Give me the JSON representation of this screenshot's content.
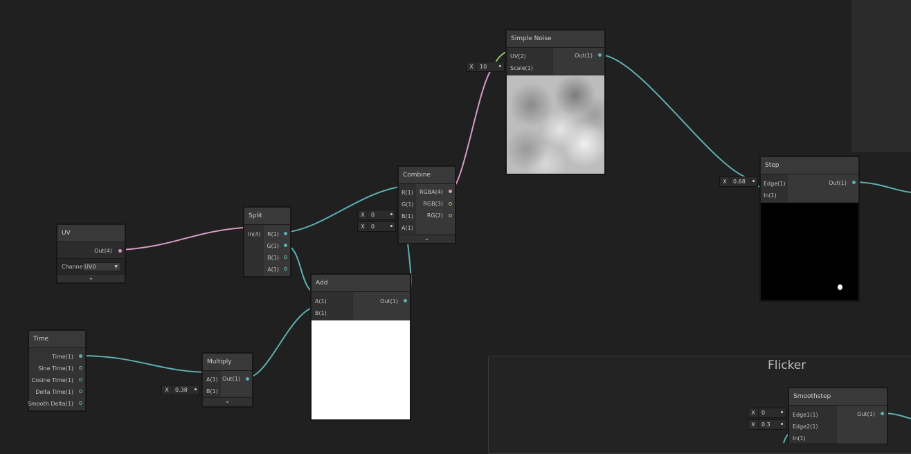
{
  "nodes": {
    "uv": {
      "title": "UV",
      "out": "Out(4)",
      "channel_label": "Channe",
      "channel_value": "UV0"
    },
    "time": {
      "title": "Time",
      "outputs": [
        "Time(1)",
        "Sine Time(1)",
        "Cosine Time(1)",
        "Delta Time(1)",
        "Smooth Delta(1)"
      ]
    },
    "split": {
      "title": "Split",
      "in": "In(4)",
      "outputs": [
        "R(1)",
        "G(1)",
        "B(1)",
        "A(1)"
      ]
    },
    "multiply": {
      "title": "Multiply",
      "inputs": [
        "A(1)",
        "B(1)"
      ],
      "out": "Out(1)",
      "b_x": "X",
      "b_value": "0.38"
    },
    "add": {
      "title": "Add",
      "inputs": [
        "A(1)",
        "B(1)"
      ],
      "out": "Out(1)"
    },
    "combine": {
      "title": "Combine",
      "inputs": [
        "R(1)",
        "G(1)",
        "B(1)",
        "A(1)"
      ],
      "outputs": [
        "RGBA(4)",
        "RGB(3)",
        "RG(2)"
      ],
      "b_x": "X",
      "b_value": "0",
      "a_x": "X",
      "a_value": "0"
    },
    "noise": {
      "title": "Simple Noise",
      "inputs": [
        "UV(2)",
        "Scale(1)"
      ],
      "out": "Out(1)",
      "scale_x": "X",
      "scale_value": "10"
    },
    "step": {
      "title": "Step",
      "inputs": [
        "Edge(1)",
        "In(1)"
      ],
      "out": "Out(1)",
      "edge_x": "X",
      "edge_value": "0.68"
    },
    "smoothstep": {
      "title": "Smoothstep",
      "inputs": [
        "Edge1(1)",
        "Edge2(1)",
        "In(1)"
      ],
      "out": "Out(1)",
      "e1_x": "X",
      "e1_value": "0",
      "e2_x": "X",
      "e2_value": "0.3"
    }
  },
  "group": {
    "title": "Flicker"
  },
  "colors": {
    "wire_float": "#5fb0b0",
    "wire_vec4": "#d59bc6",
    "wire_vec2": "#98c46d",
    "background": "#202020"
  },
  "icons": {
    "collapse": "chevron-down-icon",
    "dropdown": "triangle-down-icon"
  }
}
